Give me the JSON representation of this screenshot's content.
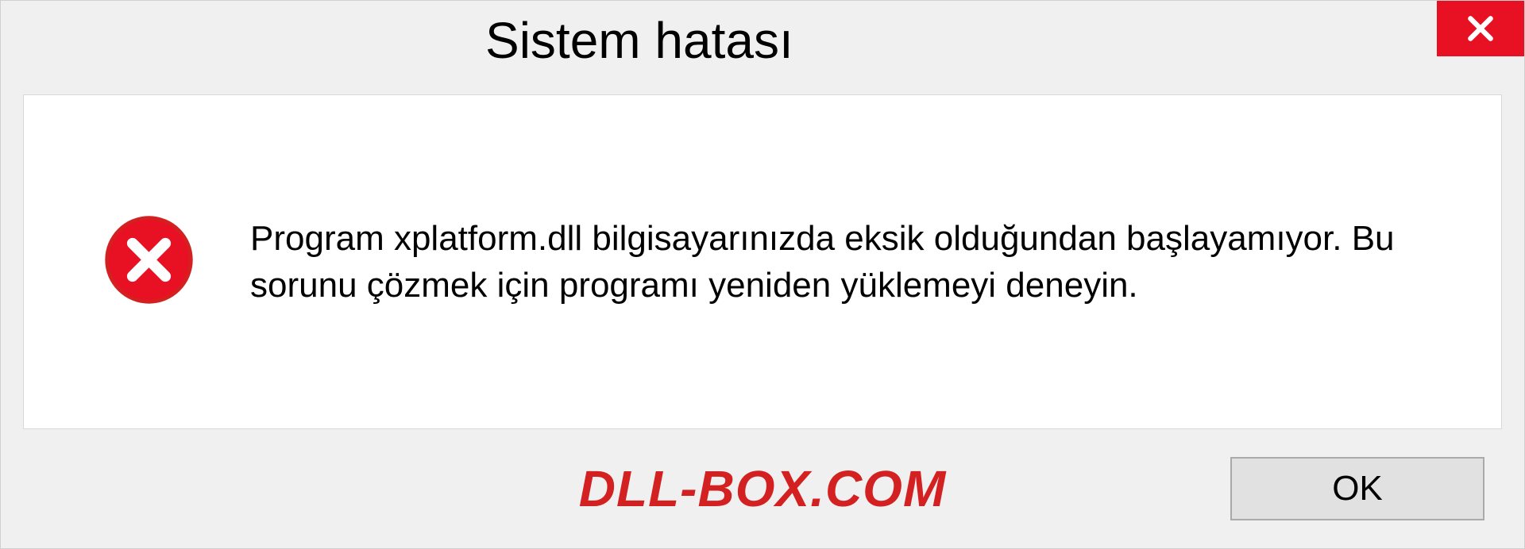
{
  "dialog": {
    "title": "Sistem hatası",
    "message": "Program xplatform.dll bilgisayarınızda eksik olduğundan başlayamıyor. Bu sorunu çözmek için programı yeniden yüklemeyi deneyin.",
    "ok_label": "OK"
  },
  "watermark": "DLL-BOX.COM"
}
